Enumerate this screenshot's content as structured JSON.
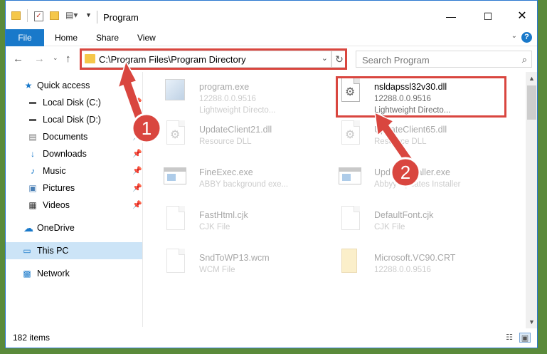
{
  "window": {
    "title": "Program"
  },
  "ribbon": {
    "file": "File",
    "home": "Home",
    "share": "Share",
    "view": "View"
  },
  "navigation": {
    "address": "C:\\Program Files\\Program Directory",
    "search_placeholder": "Search Program"
  },
  "sidebar": {
    "quick_access": "Quick access",
    "items": [
      {
        "label": "Local Disk (C:)",
        "icon": "drive-icon"
      },
      {
        "label": "Local Disk (D:)",
        "icon": "drive-icon"
      },
      {
        "label": "Documents",
        "icon": "documents-icon"
      },
      {
        "label": "Downloads",
        "icon": "download-icon"
      },
      {
        "label": "Music",
        "icon": "music-icon"
      },
      {
        "label": "Pictures",
        "icon": "pictures-icon"
      },
      {
        "label": "Videos",
        "icon": "videos-icon"
      }
    ],
    "onedrive": "OneDrive",
    "this_pc": "This PC",
    "network": "Network"
  },
  "files": [
    {
      "name": "program.exe",
      "line1": "12288.0.0.9516",
      "line2": "Lightweight Directo...",
      "icon": "exe-icon"
    },
    {
      "name": "nsldapssl32v30.dll",
      "line1": "12288.0.0.9516",
      "line2": "Lightweight Directo...",
      "icon": "dll-gear-icon"
    },
    {
      "name": "UpdateClient21.dll",
      "line1": "Resource DLL",
      "line2": "",
      "icon": "dll-gear-icon"
    },
    {
      "name": "UpdateClient65.dll",
      "line1": "Resource DLL",
      "line2": "",
      "icon": "dll-gear-icon"
    },
    {
      "name": "FineExec.exe",
      "line1": "ABBY background exe...",
      "line2": "",
      "icon": "app-window-icon"
    },
    {
      "name": "UpdateInstaller.exe",
      "line1": "Abbyy Updates Installer",
      "line2": "",
      "icon": "app-window-icon"
    },
    {
      "name": "FastHtml.cjk",
      "line1": "CJK File",
      "line2": "",
      "icon": "blank-file-icon"
    },
    {
      "name": "DefaultFont.cjk",
      "line1": "CJK File",
      "line2": "",
      "icon": "blank-file-icon"
    },
    {
      "name": "SndToWP13.wcm",
      "line1": "WCM File",
      "line2": "",
      "icon": "blank-file-icon"
    },
    {
      "name": "Microsoft.VC90.CRT",
      "line1": "12288.0.0.9516",
      "line2": "",
      "icon": "zip-folder-icon"
    }
  ],
  "status": {
    "items_count": "182 items"
  },
  "annotations": {
    "step1": "1",
    "step2": "2",
    "color": "#d9463f"
  }
}
